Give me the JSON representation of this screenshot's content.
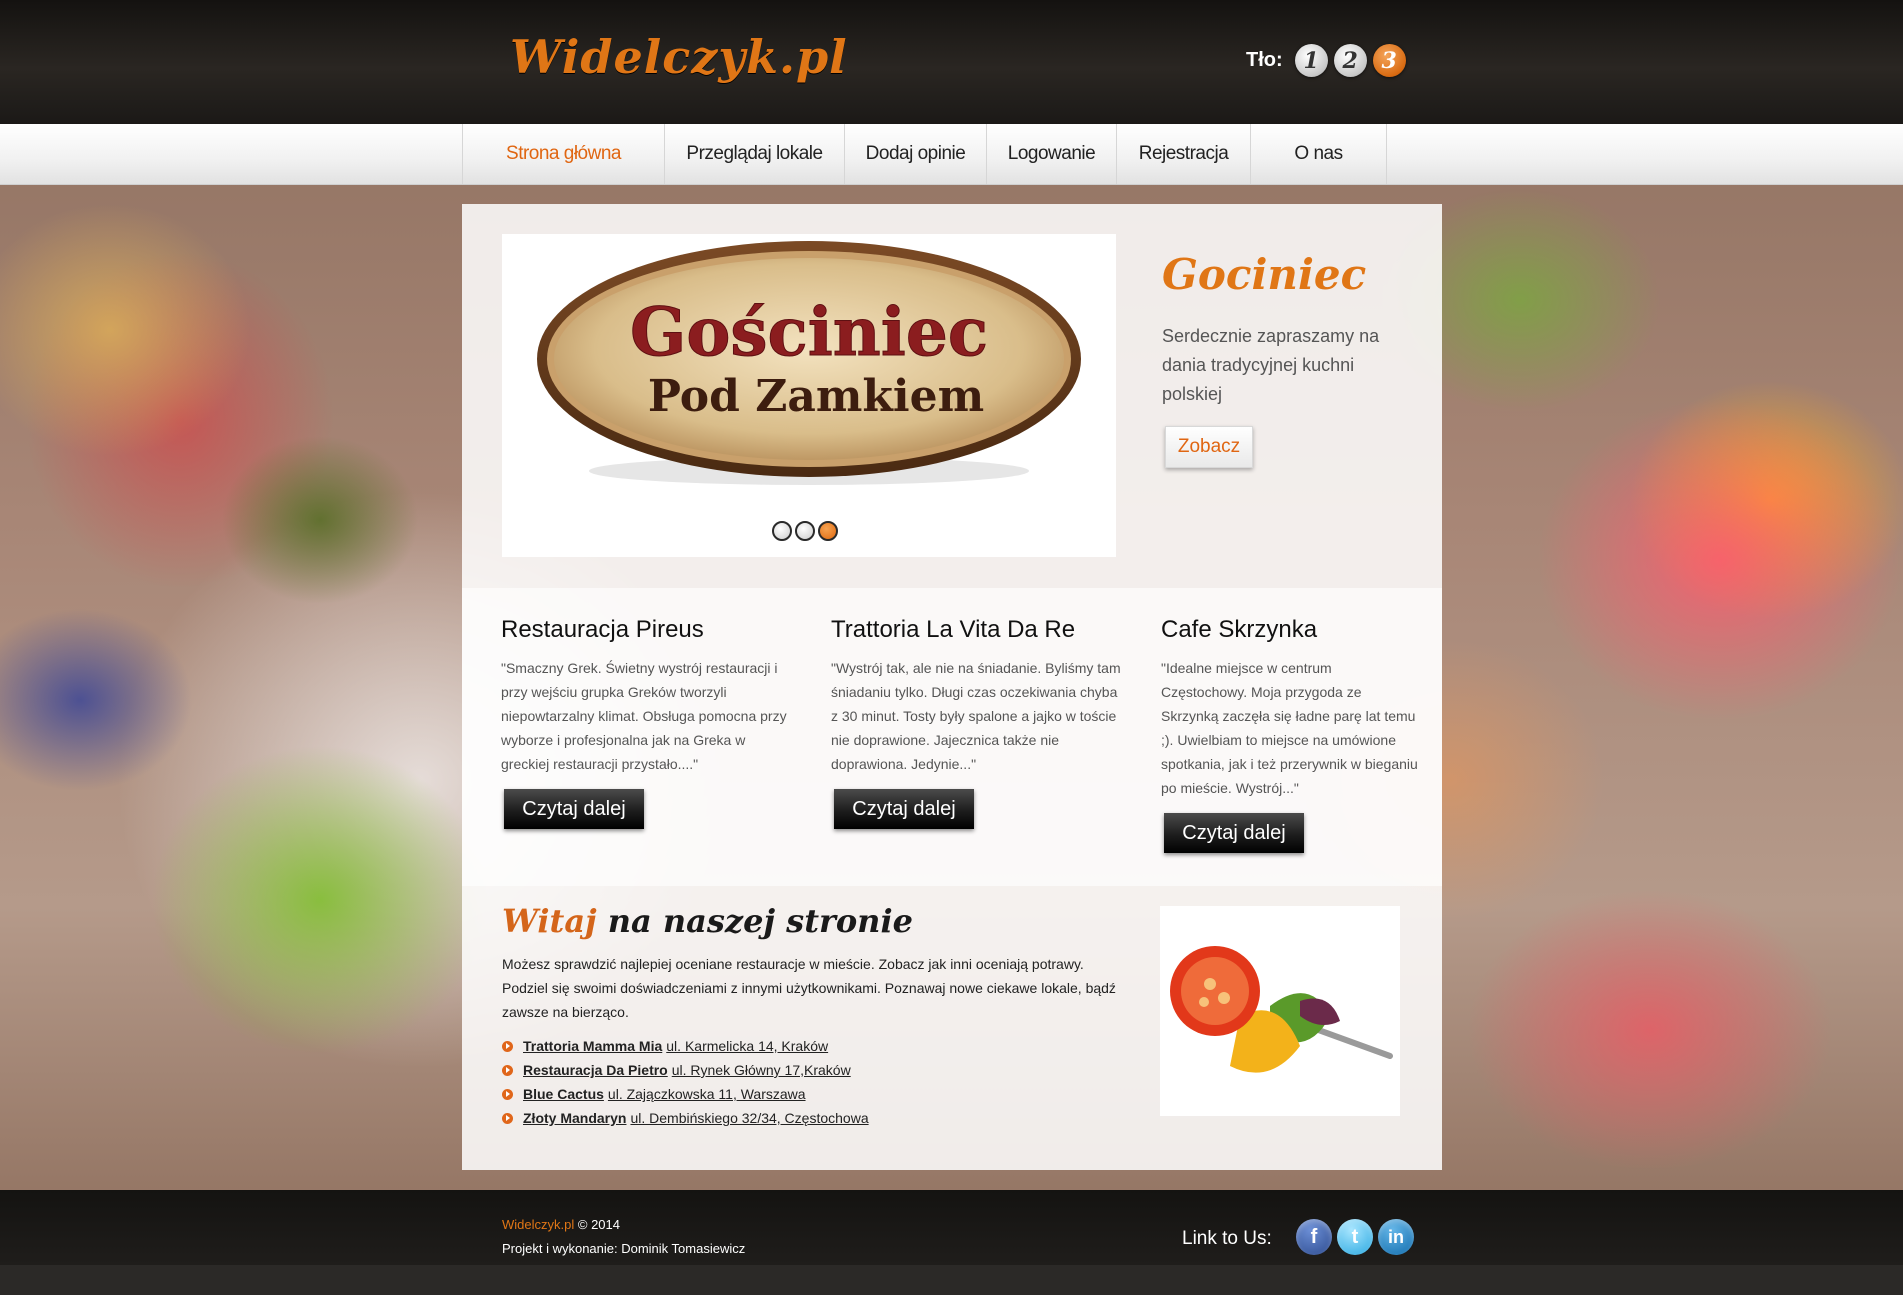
{
  "header": {
    "logo": "Widelczyk.pl",
    "background_label": "Tło:",
    "background_options": [
      "1",
      "2",
      "3"
    ],
    "background_active": "3"
  },
  "nav": {
    "items": [
      {
        "label": "Strona główna",
        "active": true
      },
      {
        "label": "Przeglądaj lokale",
        "active": false
      },
      {
        "label": "Dodaj opinie",
        "active": false
      },
      {
        "label": "Logowanie",
        "active": false
      },
      {
        "label": "Rejestracja",
        "active": false
      },
      {
        "label": "O nas",
        "active": false
      }
    ]
  },
  "slider": {
    "logo_text_line1": "Gościniec",
    "logo_text_line2": "Pod Zamkiem",
    "dots": 3,
    "active_dot": 3
  },
  "feature": {
    "title": "Gociniec",
    "text": "Serdecznie zapraszamy na dania tradycyjnej kuchni polskiej",
    "button": "Zobacz"
  },
  "reviews": [
    {
      "title": "Restauracja Pireus",
      "text": "\"Smaczny Grek. Świetny wystrój restauracji i przy wejściu grupka Greków tworzyli niepowtarzalny klimat. Obsługa pomocna przy wyborze i profesjonalna jak na Greka w greckiej restauracji przystało....\"",
      "button": "Czytaj dalej"
    },
    {
      "title": "Trattoria La Vita Da Re",
      "text": "\"Wystrój tak, ale nie na śniadanie. Byliśmy tam śniadaniu tylko. Długi czas oczekiwania chyba z 30 minut. Tosty były spalone a jajko w toście nie doprawione. Jajecznica także nie doprawiona. Jedynie...\"",
      "button": "Czytaj dalej"
    },
    {
      "title": "Cafe Skrzynka",
      "text": "\"Idealne miejsce w centrum Częstochowy. Moja przygoda ze Skrzynką zaczęła się ładne parę lat temu ;). Uwielbiam to miejsce na umówione spotkania, jak i też przerywnik w bieganiu po mieście. Wystrój...\"",
      "button": "Czytaj dalej"
    }
  ],
  "welcome": {
    "title_accent": "Witaj",
    "title_rest": "na naszej stronie",
    "text": "Możesz sprawdzić najlepiej oceniane restauracje w mieście. Zobacz jak inni oceniają potrawy. Podziel się swoimi doświadczeniami z innymi użytkownikami. Poznawaj nowe ciekawe lokale, bądź zawsze na bierząco.",
    "links": [
      {
        "name": "Trattoria Mamma Mia",
        "address": "ul. Karmelicka 14, Kraków"
      },
      {
        "name": "Restauracja Da Pietro",
        "address": "ul. Rynek Główny 17,Kraków"
      },
      {
        "name": "Blue Cactus",
        "address": "ul. Zajączkowska 11, Warszawa"
      },
      {
        "name": "Złoty Mandaryn",
        "address": "ul. Dembińskiego 32/34, Częstochowa"
      }
    ]
  },
  "footer": {
    "brand": "Widelczyk.pl",
    "copyright": "© 2014",
    "credit": "Projekt i wykonanie: Dominik Tomasiewicz",
    "link_to_us": "Link to Us:",
    "social": [
      {
        "icon": "facebook-icon",
        "glyph": "f"
      },
      {
        "icon": "twitter-icon",
        "glyph": "t"
      },
      {
        "icon": "linkedin-icon",
        "glyph": "in"
      }
    ]
  },
  "colors": {
    "accent": "#e07616",
    "dark": "#1d1d1d"
  }
}
